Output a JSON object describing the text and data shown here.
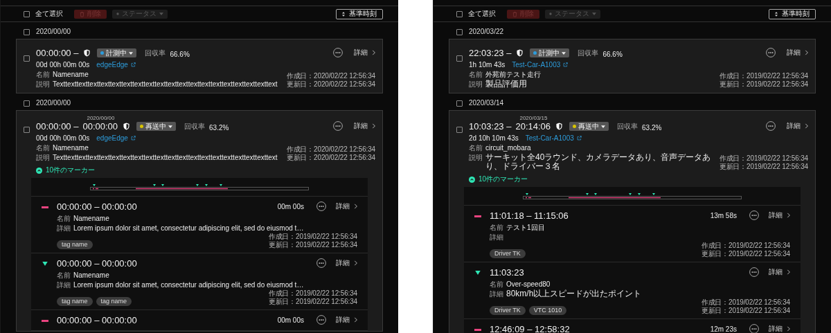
{
  "panels": [
    {
      "toolbar": {
        "select_all": {
          "label": "全て選択",
          "checked": false
        },
        "delete": {
          "label": "削除",
          "disabled": true
        },
        "status_filter": {
          "label": "ステータス",
          "disabled": true
        },
        "sort": {
          "label": "基準時刻"
        }
      },
      "groups": [
        {
          "date": "2020/00/00",
          "checked": false,
          "card": {
            "checked": false,
            "time": "00:00:00 –",
            "status": {
              "label": "計測中",
              "color": "#2d9cdb"
            },
            "rate_label": "回収率",
            "rate": "66.6%",
            "detail_link": "詳細",
            "duration": "00d 00h 00m 00s",
            "link": "edgeEdge",
            "name_label": "名前",
            "name": "Namename",
            "desc_label": "説明",
            "desc": "Texttexttexttexttexttexttexttexttexttexttexttexttexttexttexttexttexttexttexttext",
            "created": "作成日：2020/02/22 12:56:34",
            "updated": "更新日：2020/02/22 12:56:34"
          }
        },
        {
          "date": "2020/00/00",
          "checked": false,
          "card": {
            "checked": false,
            "time": "00:00:00 –",
            "end_date": "2020/00/00",
            "end_time": "00:00:00",
            "status": {
              "label": "再送中",
              "color": "#d8c400"
            },
            "rate_label": "回収率",
            "rate": "63.2%",
            "detail_link": "詳細",
            "duration": "00d 00h 00m 00s",
            "link": "edgeEdge",
            "name_label": "名前",
            "name": "Namename",
            "desc_label": "説明",
            "desc": "Texttexttexttexttexttexttexttexttexttexttexttexttexttexttexttexttexttexttexttext",
            "created": "作成日：2020/02/22 12:56:34",
            "updated": "更新日：2020/02/22 12:56:34",
            "markers": {
              "toggle": {
                "label": "10件のマーカー",
                "expanded": true
              },
              "items": [
                {
                  "kind": "range",
                  "time": "00:00:00 – 00:00:00",
                  "duration": "00m 00s",
                  "detail_link": "詳細",
                  "name_label": "名前",
                  "name": "Namename",
                  "detail_label": "詳細",
                  "detail": "Lorem ipsum dolor sit amet, consectetur adipiscing elit, sed do eiusmod t…",
                  "tags": [
                    "tag name"
                  ],
                  "created": "作成日：2019/02/22 12:56:34",
                  "updated": "更新日：2019/02/22 12:56:34"
                },
                {
                  "kind": "point",
                  "time": "00:00:00 – 00:00:00",
                  "detail_link": "詳細",
                  "name_label": "名前",
                  "name": "Namename",
                  "detail_label": "詳細",
                  "detail": "Lorem ipsum dolor sit amet, consectetur adipiscing elit, sed do eiusmod t…",
                  "tags": [
                    "tag name",
                    "tag name"
                  ],
                  "created": "作成日：2019/02/22 12:56:34",
                  "updated": "更新日：2019/02/22 12:56:34"
                },
                {
                  "kind": "range",
                  "time": "00:00:00 – 00:00:00",
                  "duration": "00m 00s",
                  "detail_link": "詳細"
                }
              ]
            }
          }
        }
      ]
    },
    {
      "toolbar": {
        "select_all": {
          "label": "全て選択",
          "checked": false
        },
        "delete": {
          "label": "削除",
          "disabled": true
        },
        "status_filter": {
          "label": "ステータス",
          "disabled": true
        },
        "sort": {
          "label": "基準時刻"
        }
      },
      "groups": [
        {
          "date": "2020/03/22",
          "checked": false,
          "card": {
            "checked": false,
            "time": "22:03:23 –",
            "status": {
              "label": "計測中",
              "color": "#2d9cdb"
            },
            "rate_label": "回収率",
            "rate": "66.6%",
            "detail_link": "詳細",
            "duration": "1h 10m 43s",
            "link": "Test-Car-A1003",
            "name_label": "名前",
            "name": "外苑前テスト走行",
            "desc_label": "説明",
            "desc": "製品評価用",
            "created": "作成日：2019/02/22 12:56:34",
            "updated": "更新日：2019/02/22 12:56:34"
          }
        },
        {
          "date": "2020/03/14",
          "checked": false,
          "card": {
            "checked": false,
            "time": "10:03:23 –",
            "end_date": "2020/03/15",
            "end_time": "20:14:06",
            "status": {
              "label": "再送中",
              "color": "#d8c400"
            },
            "rate_label": "回収率",
            "rate": "63.2%",
            "detail_link": "詳細",
            "duration": "2d 10h 10m 43s",
            "link": "Test-Car-A1003",
            "name_label": "名前",
            "name": "circuit_mobara",
            "desc_label": "説明",
            "desc": "サーキット全40ラウンド、カメラデータあり、音声データあり、ドライバー３名",
            "created": "作成日：2019/02/22 12:56:34",
            "updated": "更新日：2019/02/22 12:56:34",
            "markers": {
              "toggle": {
                "label": "10件のマーカー",
                "expanded": true
              },
              "items": [
                {
                  "kind": "range",
                  "time": "11:01:18 – 11:15:06",
                  "duration": "13m 58s",
                  "detail_link": "詳細",
                  "name_label": "名前",
                  "name": "テスト1回目",
                  "detail_label": "詳細",
                  "tags": [
                    "Driver TK"
                  ],
                  "created": "作成日：2019/02/22 12:56:34",
                  "updated": "更新日：2019/02/22 12:56:34"
                },
                {
                  "kind": "point",
                  "time": "11:03:23",
                  "detail_link": "詳細",
                  "name_label": "名前",
                  "name": "Over-speed80",
                  "detail_label": "詳細",
                  "detail": "80km/h以上スピードが出たポイント",
                  "tags": [
                    "Driver TK",
                    "VTC 1010"
                  ],
                  "created": "作成日：2019/02/22 12:56:34",
                  "updated": "更新日：2019/02/22 12:56:34"
                },
                {
                  "kind": "range",
                  "time": "12:46:09 – 12:58:32",
                  "duration": "12m 23s",
                  "detail_link": "詳細"
                }
              ]
            }
          }
        }
      ]
    }
  ]
}
